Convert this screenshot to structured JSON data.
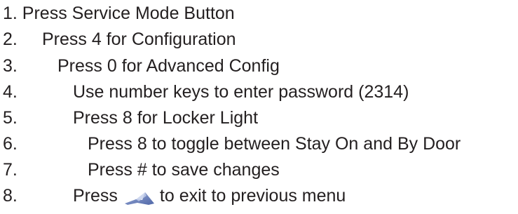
{
  "steps": [
    {
      "text": "1. Press Service Mode Button"
    },
    {
      "number": "2.",
      "text": "Press 4 for Configuration"
    },
    {
      "number": "3.",
      "text": "Press 0 for Advanced Config"
    },
    {
      "number": "4.",
      "text": "Use number keys to enter password (2314)"
    },
    {
      "number": "5.",
      "text": "Press 8 for Locker Light"
    },
    {
      "number": "6.",
      "text": "Press 8 to toggle between Stay On and By Door"
    },
    {
      "number": "7.",
      "text": "Press # to save changes"
    },
    {
      "number": "8.",
      "text_before": "Press",
      "icon": "back-arrow-icon",
      "text_after": "to exit to previous menu"
    }
  ],
  "colors": {
    "text": "#231f20",
    "icon": "#6f86c4"
  }
}
